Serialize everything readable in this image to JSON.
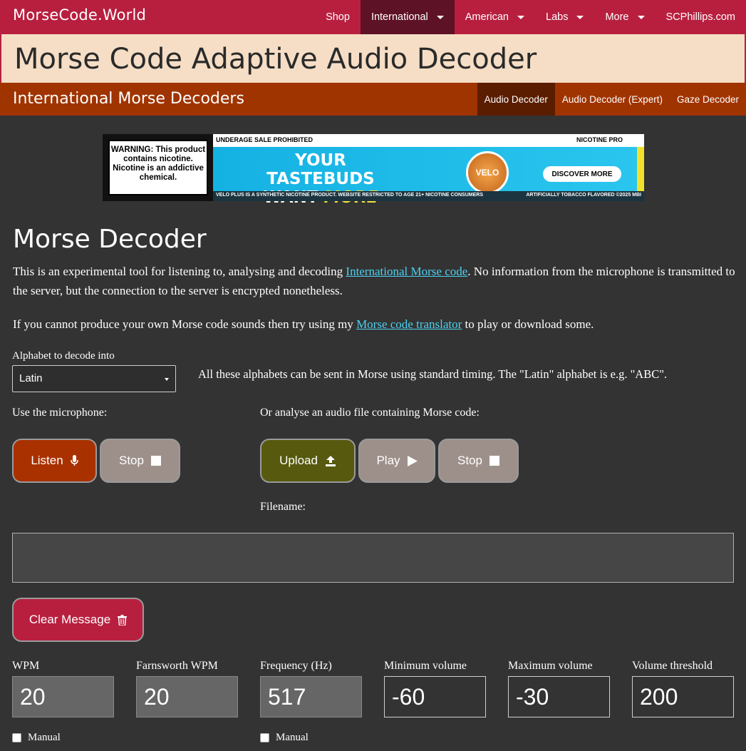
{
  "nav": {
    "brand": "MorseCode.World",
    "items": [
      {
        "label": "Shop",
        "caret": false,
        "active": false
      },
      {
        "label": "International",
        "caret": true,
        "active": true
      },
      {
        "label": "American",
        "caret": true,
        "active": false
      },
      {
        "label": "Labs",
        "caret": true,
        "active": false
      },
      {
        "label": "More",
        "caret": true,
        "active": false
      },
      {
        "label": "SCPhillips.com",
        "caret": false,
        "active": false
      }
    ]
  },
  "title": "Morse Code Adaptive Audio Decoder",
  "subnav": {
    "title": "International Morse Decoders",
    "items": [
      {
        "label": "Audio Decoder",
        "active": true
      },
      {
        "label": "Audio Decoder (Expert)",
        "active": false
      },
      {
        "label": "Gaze Decoder",
        "active": false
      }
    ]
  },
  "ad": {
    "warning": "WARNING: This product contains nicotine. Nicotine is an addictive chemical.",
    "top_strip": "UNDERAGE SALE PROHIBITED",
    "brand_right": "NICOTINE PRO",
    "headline_1": "YOUR TASTEBUDS",
    "headline_2a": "WANT ",
    "headline_2b": "MORE",
    "can_label": "VELO",
    "cta": "DISCOVER MORE",
    "bottom": "VELO PLUS IS A SYNTHETIC NICOTINE PRODUCT. WEBSITE RESTRICTED TO AGE 21+ NICOTINE CONSUMERS",
    "bottom_right": "ARTIFICIALLY TOBACCO FLAVORED ©2025 MBI"
  },
  "content": {
    "heading": "Morse Decoder",
    "p1_a": "This is an experimental tool for listening to, analysing and decoding ",
    "p1_link": "International Morse code",
    "p1_b": ". No information from the microphone is transmitted to the server, but the connection to the server is encrypted nonetheless.",
    "p2_a": "If you cannot produce your own Morse code sounds then try using my ",
    "p2_link": "Morse code translator",
    "p2_b": " to play or download some.",
    "alphabet_label": "Alphabet to decode into",
    "alphabet_value": "Latin",
    "alphabet_note": "All these alphabets can be sent in Morse using standard timing. The \"Latin\" alphabet is e.g. \"ABC\".",
    "mic_label": "Use the microphone:",
    "file_label": "Or analyse an audio file containing Morse code:",
    "filename_label": "Filename:"
  },
  "buttons": {
    "listen": "Listen",
    "stop": "Stop",
    "upload": "Upload",
    "play": "Play",
    "clear": "Clear Message"
  },
  "settings": [
    {
      "label": "WPM",
      "value": "20",
      "disabled": true,
      "manual": true
    },
    {
      "label": "Farnsworth WPM",
      "value": "20",
      "disabled": true,
      "manual": false
    },
    {
      "label": "Frequency (Hz)",
      "value": "517",
      "disabled": true,
      "manual": true
    },
    {
      "label": "Minimum volume",
      "value": "-60",
      "disabled": false,
      "manual": false
    },
    {
      "label": "Maximum volume",
      "value": "-30",
      "disabled": false,
      "manual": false
    },
    {
      "label": "Volume threshold",
      "value": "200",
      "disabled": false,
      "manual": false
    }
  ],
  "manual_label": "Manual"
}
